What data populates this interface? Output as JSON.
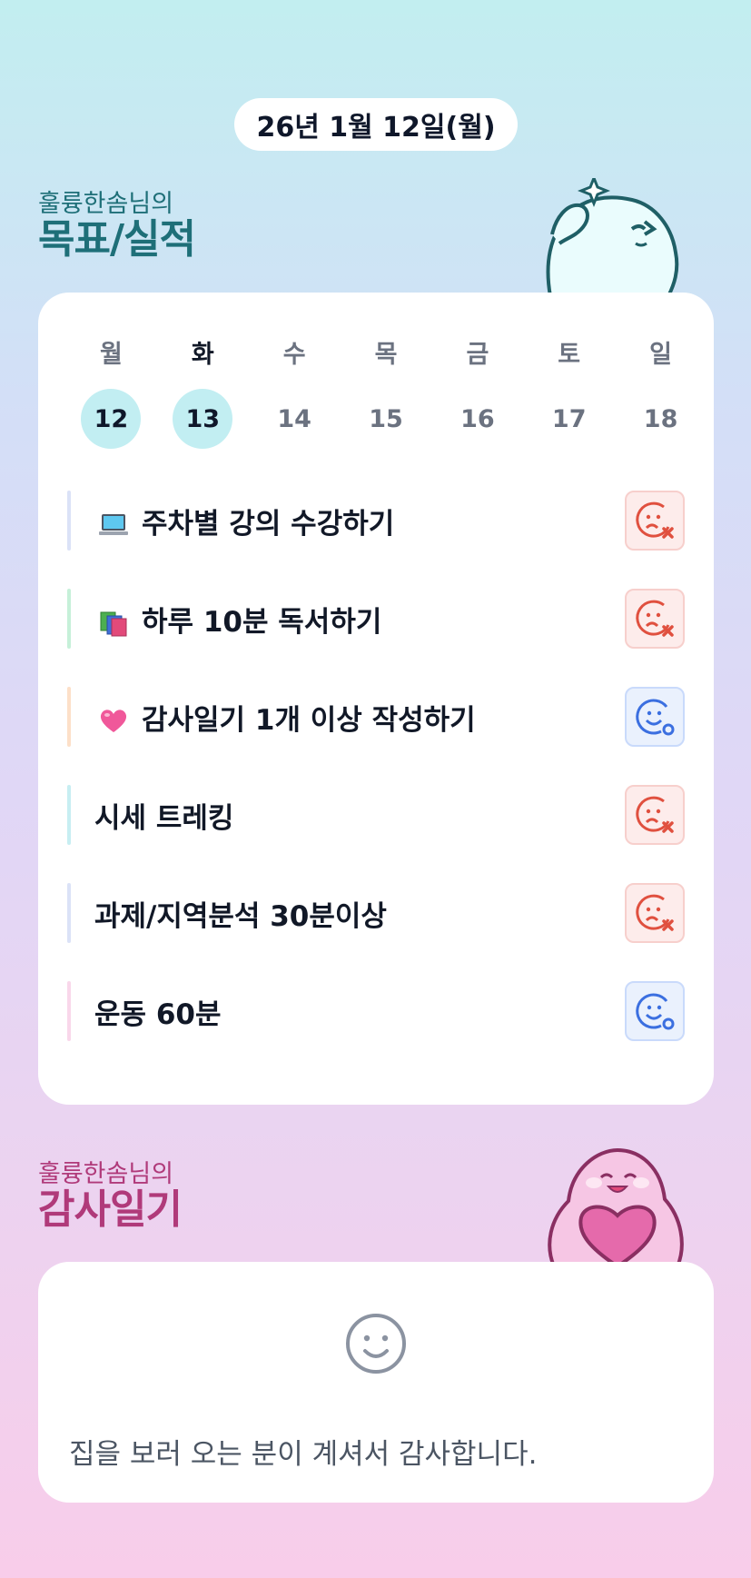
{
  "header": {
    "date": "26년 1월 12일(월)"
  },
  "goals_section": {
    "owner": "훌륭한솜님의",
    "title": "목표/실적"
  },
  "week": {
    "days_of_week": [
      "월",
      "화",
      "수",
      "목",
      "금",
      "토",
      "일"
    ],
    "dates": [
      "12",
      "13",
      "14",
      "15",
      "16",
      "17",
      "18"
    ],
    "highlighted": [
      "12",
      "13"
    ],
    "active_day_label": "화"
  },
  "goals": [
    {
      "emoji": "laptop-icon",
      "label": "주차별 강의 수강하기",
      "status": "fail",
      "bar_color": "#dbe2f7"
    },
    {
      "emoji": "books-icon",
      "label": "하루 10분 독서하기",
      "status": "fail",
      "bar_color": "#c6f0d9"
    },
    {
      "emoji": "heart-icon",
      "label": "감사일기 1개 이상 작성하기",
      "status": "pass",
      "bar_color": "#fde0c8"
    },
    {
      "emoji": "",
      "label": "시세 트레킹",
      "status": "fail",
      "bar_color": "#c7eef2"
    },
    {
      "emoji": "",
      "label": "과제/지역분석 30분이상",
      "status": "fail",
      "bar_color": "#dbe2f7"
    },
    {
      "emoji": "",
      "label": "운동 60분",
      "status": "pass",
      "bar_color": "#f9d7ea"
    }
  ],
  "diary_section": {
    "owner": "훌륭한솜님의",
    "title": "감사일기"
  },
  "diary": {
    "entry": "집을 보러 오는 분이 계셔서 감사합니다.",
    "icon": "smile-face-icon"
  },
  "colors": {
    "teal_heading": "#1e6f78",
    "pink_heading": "#b03a7a",
    "fail": "#e0503f",
    "pass": "#3b6fe0"
  }
}
